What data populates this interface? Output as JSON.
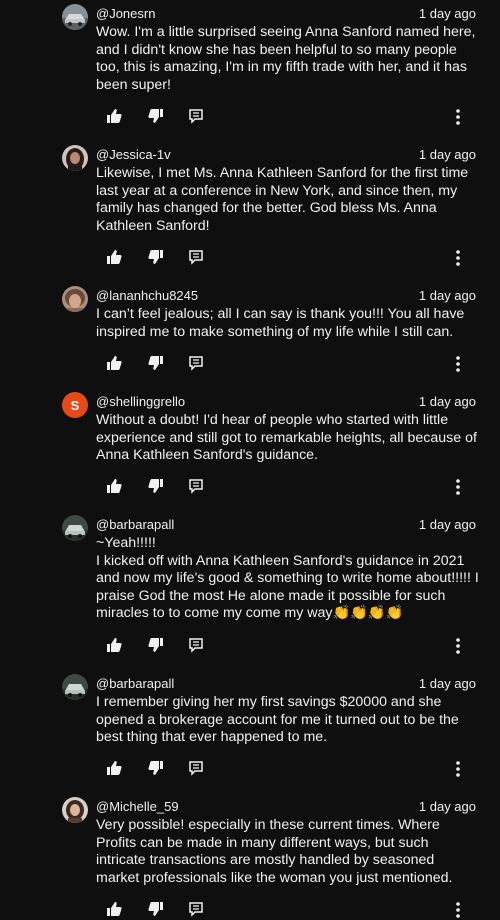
{
  "comments": [
    {
      "username": "@Jonesrn",
      "time": "1 day ago",
      "text": "Wow. I'm a little surprised seeing Anna Sanford named here, and I didn't know she has been helpful to so many people too, this is amazing, I'm in my fifth trade with her, and it has been super!",
      "avatar": "car-photo"
    },
    {
      "username": "@Jessica-1v",
      "time": "1 day ago",
      "text": "Likewise, I met Ms. Anna Kathleen Sanford for the first time last year at a conference in New York, and since then, my family has changed for the better. God bless Ms. Anna Kathleen Sanford!",
      "avatar": "woman-photo"
    },
    {
      "username": "@lananhchu8245",
      "time": "1 day ago",
      "text": "I can’t feel jealous; all I can say is thank you!!! You all have inspired me to make something of my life while I still can.",
      "avatar": "face-photo"
    },
    {
      "username": "@shellinggrello",
      "time": "1 day ago",
      "text": "Without a doubt! I'd hear of people who started with little experience and still got to remarkable heights, all because of Anna Kathleen Sanford's guidance.",
      "avatar_letter": "S"
    },
    {
      "username": "@barbarapall",
      "time": "1 day ago",
      "text": "~Yeah!!!!!\nI kicked off with Anna Kathleen Sanford's guidance in 2021 and now my life's good & something to write home about!!!!! I praise God the most He alone made it possible for such miracles to to come my come my way👏👏👏👏",
      "avatar": "car-photo"
    },
    {
      "username": "@barbarapall",
      "time": "1 day ago",
      "text": "I remember giving her my first savings $20000 and she opened a brokerage account for me it turned out to be the best thing that ever happened to me.",
      "avatar": "car-photo"
    },
    {
      "username": "@Michelle_59",
      "time": "1 day ago",
      "text": "Very possible! especially in these current times. Where Profits can be made in many different ways, but such intricate transactions are mostly handled by seasoned market professionals like the woman you just mentioned.",
      "avatar": "woman-photo"
    }
  ],
  "icons": {
    "like": "thumbs-up-icon",
    "dislike": "thumbs-down-icon",
    "reply": "reply-icon",
    "more": "more-vertical-icon"
  },
  "colors": {
    "background": "#0f0f0f",
    "text": "#f1f1f1",
    "letter_avatar": "#e64a19"
  }
}
